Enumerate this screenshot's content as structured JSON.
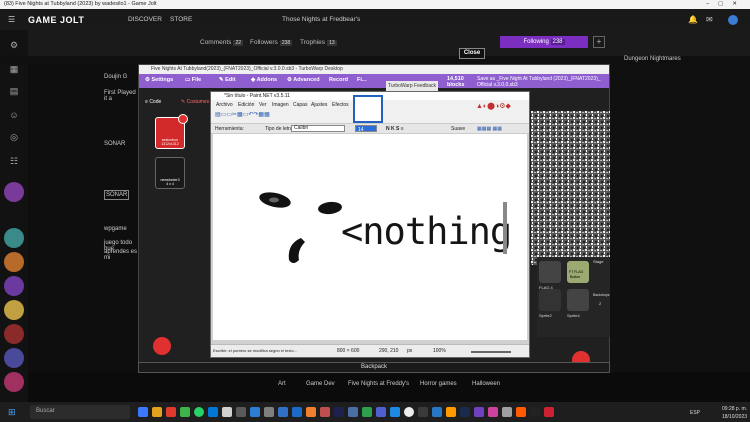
{
  "browser": {
    "title": "(83) Five Nights at Tubbyland (2023) by wadesilo1 - Game Jolt"
  },
  "gamejolt": {
    "logo": "GAME JOLT",
    "nav": [
      "DISCOVER",
      "STORE"
    ],
    "page_title": "Those Nights at Fredbear's",
    "stats": [
      {
        "label": "Comments",
        "count": "22"
      },
      {
        "label": "Followers",
        "count": "238"
      },
      {
        "label": "Trophies",
        "count": "13"
      }
    ],
    "follow_label": "Following",
    "follow_count": "238",
    "plus_label": "+",
    "close_label": "Close",
    "right_heading": "Dungeon Nightmares",
    "left_texts": [
      "Doujin G",
      "First Played it a",
      "SONAR",
      "SONAR",
      "wpgame",
      "juego todo bue",
      "aprendes es mi"
    ],
    "backpack_label": "Backpack",
    "tags": [
      "Art",
      "Game Dev",
      "Five Nights at Freddy's",
      "Horror games",
      "Halloween"
    ]
  },
  "turbowarp": {
    "window_title": "Five Nights At Tubbyland(2023)_(FNAT2023)_Official v.3.0.0.sb3 - TurboWarp Desktop",
    "menu": [
      "Settings",
      "File",
      "Edit",
      "Addons",
      "Advanced",
      "Record",
      "Fi..."
    ],
    "feedback_label": "TurboWarp Feedback",
    "block_count_line1": "14,510",
    "block_count_line2": "blocks",
    "save_as": "Save as _Five Night At Tubbyland (2023)_(FNAT2023)_ Official v.3.0.0.sb3",
    "tabs": [
      "Code",
      "Costumes"
    ],
    "sprites": [
      {
        "name": "sesionfour",
        "sub": "1312x1312"
      },
      {
        "name": "newsfooter3",
        "sub": "4 x 4"
      }
    ],
    "stage_panel": {
      "items": [
        {
          "label": "FLAG 4",
          "sub": ""
        },
        {
          "label": "FT FLAG",
          "sub": "Button"
        },
        {
          "label": "Sprite2",
          "sub": ""
        },
        {
          "label": "Sprite4",
          "sub": ""
        }
      ],
      "stage_label": "Stage",
      "backdrops_label": "Backdrops",
      "backdrops_count": "2"
    }
  },
  "paintnet": {
    "title": "*Sin título - Paint.NET v3.5.11",
    "menu": [
      "Archivo",
      "Edición",
      "Ver",
      "Imagen",
      "Capas",
      "Ajustes",
      "Efectos"
    ],
    "toolbar": {
      "tool_label": "Herramienta:",
      "font_label": "Tipo de letra:",
      "font_value": "Calibri",
      "size_value": "14",
      "render_label": "Suave"
    },
    "canvas_text": "<nothing",
    "status": {
      "hint": "Escribir: el puntero se modifica según el texto...",
      "size": "800 × 600",
      "coords": "290, 210",
      "unit": "px",
      "zoom": "100%"
    }
  },
  "taskbar": {
    "search_placeholder": "Buscar",
    "language": "ESP",
    "time": "09:28 p. m.",
    "date": "18/10/2023"
  },
  "colors": {
    "gamejolt_purple": "#7b2ec0",
    "turbowarp_purple": "#8f5fd0",
    "scratch_red": "#e03030"
  }
}
